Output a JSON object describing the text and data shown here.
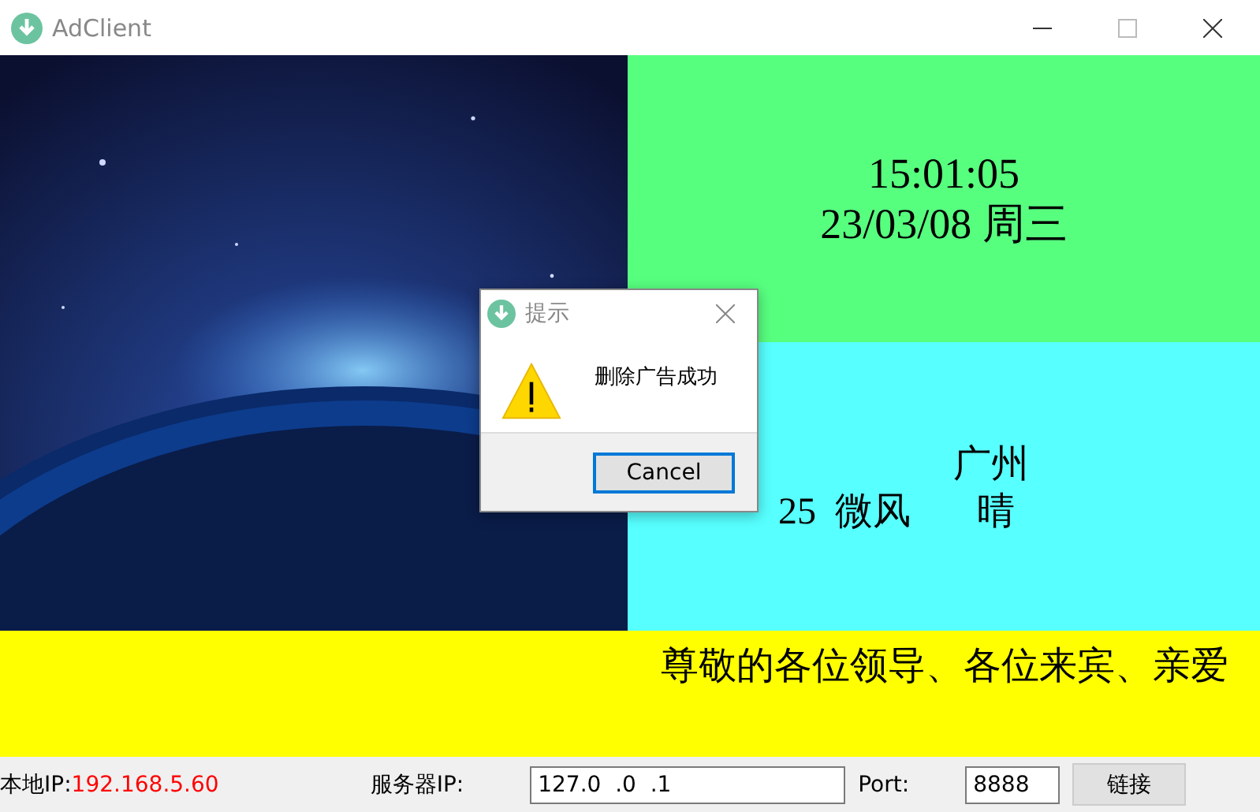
{
  "window": {
    "title": "AdClient"
  },
  "clock": {
    "time": "15:01:05",
    "date": "23/03/08 周三"
  },
  "weather": {
    "city": "广州",
    "temperature": "25",
    "wind": "微风",
    "condition": "晴"
  },
  "marquee": {
    "text": "尊敬的各位领导、各位来宾、亲爱"
  },
  "status_bar": {
    "local_ip_label": "本地IP:",
    "local_ip": "192.168.5.60",
    "server_ip_label": "服务器IP:",
    "server_ip": "127.0  .0  .1",
    "port_label": "Port:",
    "port": "8888",
    "connect_button": "链接"
  },
  "dialog": {
    "title": "提示",
    "message": "删除广告成功",
    "buttons": [
      {
        "label": "Cancel",
        "selected": true
      }
    ]
  }
}
